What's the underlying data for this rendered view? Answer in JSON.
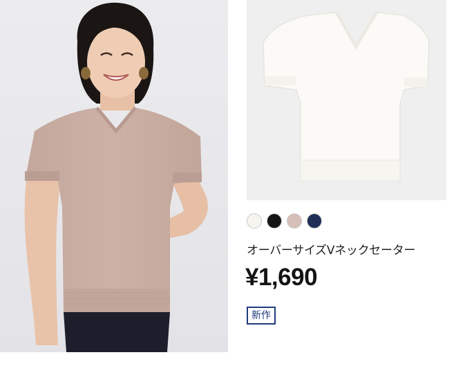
{
  "product": {
    "name": "オーバーサイズVネックセーター",
    "price": "¥1,690",
    "badge": "新作"
  },
  "swatches": [
    {
      "name": "swatch-white",
      "color": "#f5f4ef"
    },
    {
      "name": "swatch-black",
      "color": "#151515"
    },
    {
      "name": "swatch-pink",
      "color": "#d7bfb8"
    },
    {
      "name": "swatch-navy",
      "color": "#1f2f55"
    }
  ],
  "colors": {
    "badge": "#1f3a7a",
    "model_sweater": "#c9ada2",
    "product_sweater": "#fbfaf6"
  }
}
